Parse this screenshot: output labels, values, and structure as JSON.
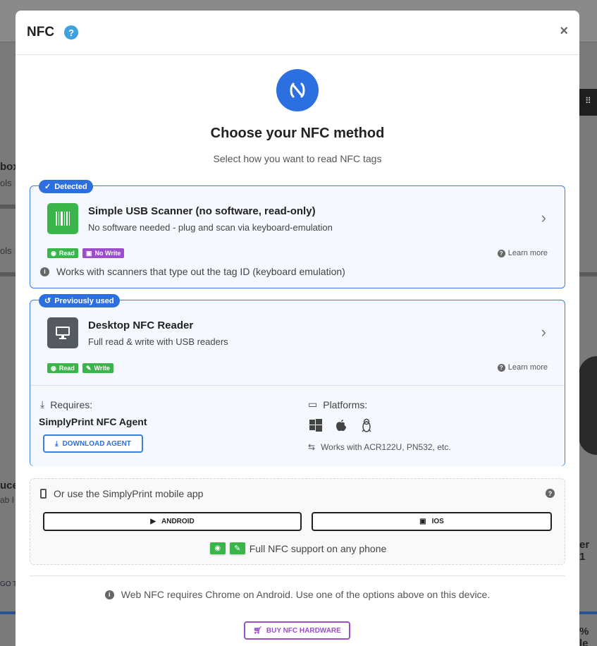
{
  "background": {
    "left_fragments": [
      "box",
      "ols",
      "ols",
      "uce",
      "ab I",
      "GO T"
    ],
    "right_fragments": [
      "er 1",
      "% le"
    ],
    "right_dark_glyph": "⠿"
  },
  "modal": {
    "title": "NFC",
    "help_badge": "?",
    "close": "×"
  },
  "hero": {
    "title": "Choose your NFC method",
    "subtitle": "Select how you want to read NFC tags"
  },
  "usb_card": {
    "badge": "Detected",
    "title": "Simple USB Scanner (no software, read-only)",
    "description": "No software needed - plug and scan via keyboard-emulation",
    "tags": [
      "Read",
      "No Write"
    ],
    "learn_more": "Learn more",
    "note": "Works with scanners that type out the tag ID (keyboard emulation)"
  },
  "desktop_card": {
    "badge": "Previously used",
    "title": "Desktop NFC Reader",
    "description": "Full read & write with USB readers",
    "tags": [
      "Read",
      "Write"
    ],
    "learn_more": "Learn more",
    "requires_label": "Requires:",
    "requires_value": "SimplyPrint NFC Agent",
    "download_button": "DOWNLOAD AGENT",
    "platforms_label": "Platforms:",
    "platform_icons": [
      "windows-icon",
      "apple-icon",
      "linux-icon"
    ],
    "compat_note": "Works with ACR122U, PN532, etc."
  },
  "mobile": {
    "label": "Or use the SimplyPrint mobile app",
    "android_button": "ANDROID",
    "ios_button": "IOS",
    "feature_text": "Full NFC support on any phone"
  },
  "web_note": "Web NFC requires Chrome on Android. Use one of the options above on this device.",
  "buy_button": "BUY NFC HARDWARE",
  "colors": {
    "primary": "#2c6fe0",
    "green": "#3ab54a",
    "purple": "#9b4dca"
  }
}
